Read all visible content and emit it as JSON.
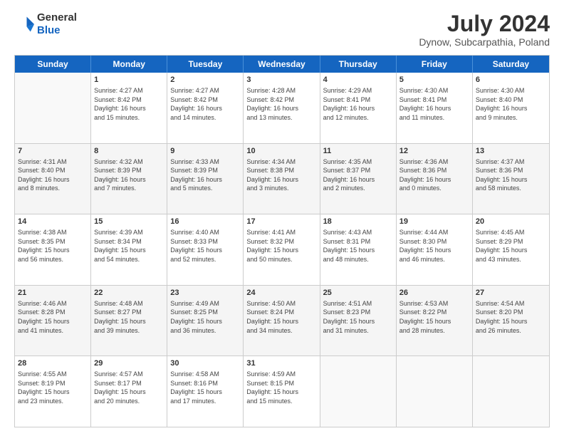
{
  "header": {
    "logo_line1": "General",
    "logo_line2": "Blue",
    "month": "July 2024",
    "location": "Dynow, Subcarpathia, Poland"
  },
  "days": [
    "Sunday",
    "Monday",
    "Tuesday",
    "Wednesday",
    "Thursday",
    "Friday",
    "Saturday"
  ],
  "rows": [
    [
      {
        "day": "",
        "info": ""
      },
      {
        "day": "1",
        "info": "Sunrise: 4:27 AM\nSunset: 8:42 PM\nDaylight: 16 hours\nand 15 minutes."
      },
      {
        "day": "2",
        "info": "Sunrise: 4:27 AM\nSunset: 8:42 PM\nDaylight: 16 hours\nand 14 minutes."
      },
      {
        "day": "3",
        "info": "Sunrise: 4:28 AM\nSunset: 8:42 PM\nDaylight: 16 hours\nand 13 minutes."
      },
      {
        "day": "4",
        "info": "Sunrise: 4:29 AM\nSunset: 8:41 PM\nDaylight: 16 hours\nand 12 minutes."
      },
      {
        "day": "5",
        "info": "Sunrise: 4:30 AM\nSunset: 8:41 PM\nDaylight: 16 hours\nand 11 minutes."
      },
      {
        "day": "6",
        "info": "Sunrise: 4:30 AM\nSunset: 8:40 PM\nDaylight: 16 hours\nand 9 minutes."
      }
    ],
    [
      {
        "day": "7",
        "info": "Sunrise: 4:31 AM\nSunset: 8:40 PM\nDaylight: 16 hours\nand 8 minutes."
      },
      {
        "day": "8",
        "info": "Sunrise: 4:32 AM\nSunset: 8:39 PM\nDaylight: 16 hours\nand 7 minutes."
      },
      {
        "day": "9",
        "info": "Sunrise: 4:33 AM\nSunset: 8:39 PM\nDaylight: 16 hours\nand 5 minutes."
      },
      {
        "day": "10",
        "info": "Sunrise: 4:34 AM\nSunset: 8:38 PM\nDaylight: 16 hours\nand 3 minutes."
      },
      {
        "day": "11",
        "info": "Sunrise: 4:35 AM\nSunset: 8:37 PM\nDaylight: 16 hours\nand 2 minutes."
      },
      {
        "day": "12",
        "info": "Sunrise: 4:36 AM\nSunset: 8:36 PM\nDaylight: 16 hours\nand 0 minutes."
      },
      {
        "day": "13",
        "info": "Sunrise: 4:37 AM\nSunset: 8:36 PM\nDaylight: 15 hours\nand 58 minutes."
      }
    ],
    [
      {
        "day": "14",
        "info": "Sunrise: 4:38 AM\nSunset: 8:35 PM\nDaylight: 15 hours\nand 56 minutes."
      },
      {
        "day": "15",
        "info": "Sunrise: 4:39 AM\nSunset: 8:34 PM\nDaylight: 15 hours\nand 54 minutes."
      },
      {
        "day": "16",
        "info": "Sunrise: 4:40 AM\nSunset: 8:33 PM\nDaylight: 15 hours\nand 52 minutes."
      },
      {
        "day": "17",
        "info": "Sunrise: 4:41 AM\nSunset: 8:32 PM\nDaylight: 15 hours\nand 50 minutes."
      },
      {
        "day": "18",
        "info": "Sunrise: 4:43 AM\nSunset: 8:31 PM\nDaylight: 15 hours\nand 48 minutes."
      },
      {
        "day": "19",
        "info": "Sunrise: 4:44 AM\nSunset: 8:30 PM\nDaylight: 15 hours\nand 46 minutes."
      },
      {
        "day": "20",
        "info": "Sunrise: 4:45 AM\nSunset: 8:29 PM\nDaylight: 15 hours\nand 43 minutes."
      }
    ],
    [
      {
        "day": "21",
        "info": "Sunrise: 4:46 AM\nSunset: 8:28 PM\nDaylight: 15 hours\nand 41 minutes."
      },
      {
        "day": "22",
        "info": "Sunrise: 4:48 AM\nSunset: 8:27 PM\nDaylight: 15 hours\nand 39 minutes."
      },
      {
        "day": "23",
        "info": "Sunrise: 4:49 AM\nSunset: 8:25 PM\nDaylight: 15 hours\nand 36 minutes."
      },
      {
        "day": "24",
        "info": "Sunrise: 4:50 AM\nSunset: 8:24 PM\nDaylight: 15 hours\nand 34 minutes."
      },
      {
        "day": "25",
        "info": "Sunrise: 4:51 AM\nSunset: 8:23 PM\nDaylight: 15 hours\nand 31 minutes."
      },
      {
        "day": "26",
        "info": "Sunrise: 4:53 AM\nSunset: 8:22 PM\nDaylight: 15 hours\nand 28 minutes."
      },
      {
        "day": "27",
        "info": "Sunrise: 4:54 AM\nSunset: 8:20 PM\nDaylight: 15 hours\nand 26 minutes."
      }
    ],
    [
      {
        "day": "28",
        "info": "Sunrise: 4:55 AM\nSunset: 8:19 PM\nDaylight: 15 hours\nand 23 minutes."
      },
      {
        "day": "29",
        "info": "Sunrise: 4:57 AM\nSunset: 8:17 PM\nDaylight: 15 hours\nand 20 minutes."
      },
      {
        "day": "30",
        "info": "Sunrise: 4:58 AM\nSunset: 8:16 PM\nDaylight: 15 hours\nand 17 minutes."
      },
      {
        "day": "31",
        "info": "Sunrise: 4:59 AM\nSunset: 8:15 PM\nDaylight: 15 hours\nand 15 minutes."
      },
      {
        "day": "",
        "info": ""
      },
      {
        "day": "",
        "info": ""
      },
      {
        "day": "",
        "info": ""
      }
    ]
  ]
}
